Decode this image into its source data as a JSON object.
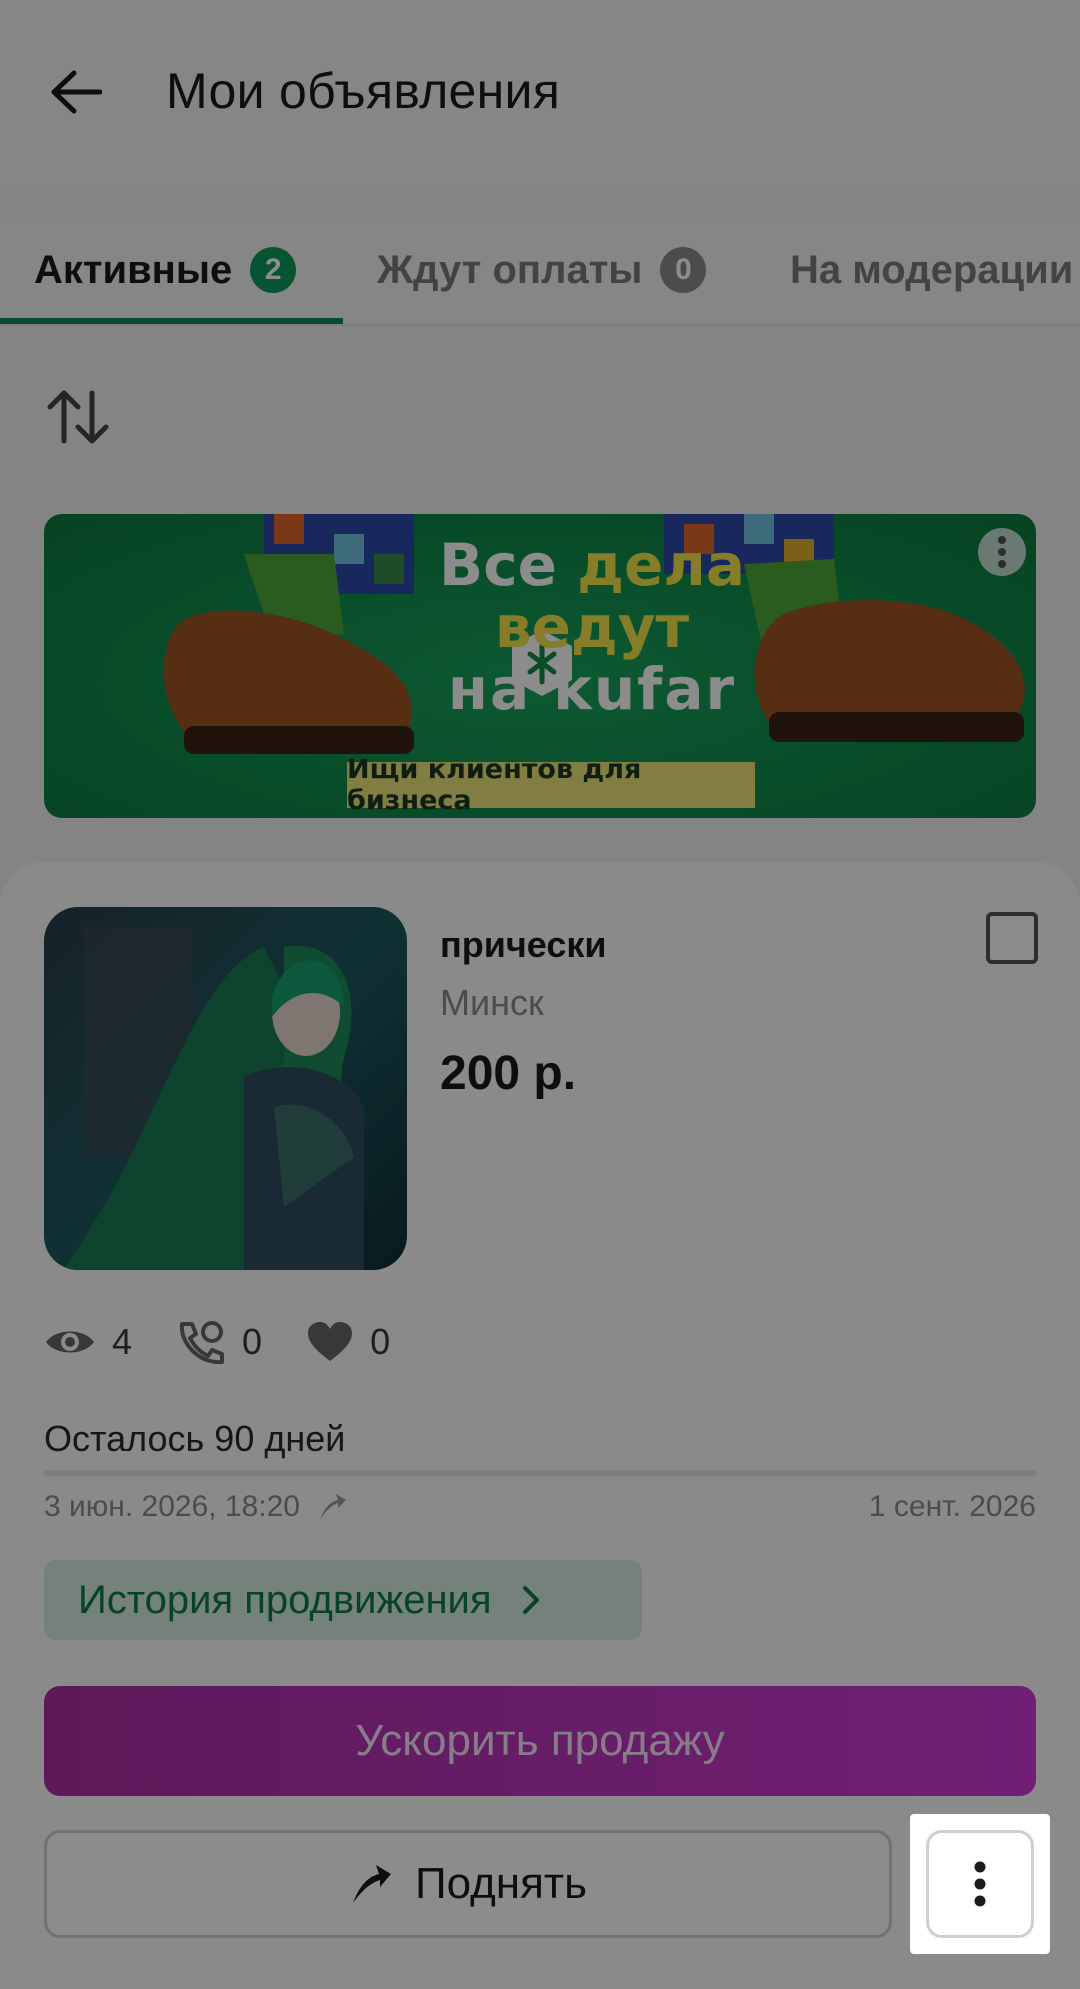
{
  "header": {
    "title": "Мои объявления",
    "back_icon": "arrow-left-icon"
  },
  "tabs": [
    {
      "label": "Активные",
      "count": "2",
      "active": true
    },
    {
      "label": "Ждут оплаты",
      "count": "0",
      "active": false
    },
    {
      "label": "На модерации",
      "active": false
    }
  ],
  "sort_icon": "sort-arrows-icon",
  "banner": {
    "line1_a": "Все ",
    "line1_b": "дела",
    "line2": "ведут",
    "line3": "на kufar",
    "cta": "Ищи клиентов для бизнеса",
    "menu_icon": "kebab-icon"
  },
  "listing": {
    "title": "прически",
    "city": "Минск",
    "price": "200 р.",
    "stats": {
      "views": "4",
      "calls": "0",
      "favorites": "0"
    },
    "remaining": "Осталось 90 дней",
    "date_start": "3 июн. 2026, 18:20",
    "date_end": "1 сент. 2026",
    "history_label": "История продвижения",
    "boost_label": "Ускорить продажу",
    "raise_label": "Поднять",
    "colors": {
      "accent": "#0b9a5a",
      "boost": "#c53ad0"
    }
  }
}
